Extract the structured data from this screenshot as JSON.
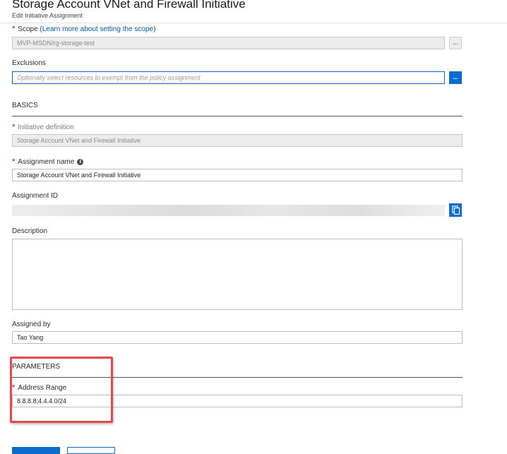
{
  "header": {
    "title": "Storage Account VNet and Firewall Initiative",
    "subtitle": "Edit Initiative Assignment"
  },
  "scope": {
    "label": "Scope",
    "link_text": "(Learn more about setting the scope)",
    "value": "MVP-MSDN/rg-storage-test",
    "browse_button": "..."
  },
  "exclusions": {
    "label": "Exclusions",
    "placeholder": "Optionally select resources to exempt from the policy assignment",
    "browse_button": "..."
  },
  "basics": {
    "heading": "BASICS",
    "initiative_definition": {
      "label": "Initiative definition",
      "value": "Storage Account VNet and Firewall Initiative"
    },
    "assignment_name": {
      "label": "Assignment name",
      "value": "Storage Account VNet and Firewall Initiative"
    },
    "assignment_id": {
      "label": "Assignment ID"
    },
    "description": {
      "label": "Description",
      "value": ""
    },
    "assigned_by": {
      "label": "Assigned by",
      "value": "Tao Yang"
    }
  },
  "parameters": {
    "heading": "PARAMETERS",
    "address_range": {
      "label": "Address Range",
      "value": "8.8.8.8;4.4.4.0/24"
    }
  },
  "icons": {
    "required": "asterisk-required-icon",
    "info": "info-icon",
    "copy": "copy-icon"
  },
  "colors": {
    "accent": "#0b6ccf",
    "required": "#c50000",
    "highlight": "#e5484d"
  }
}
